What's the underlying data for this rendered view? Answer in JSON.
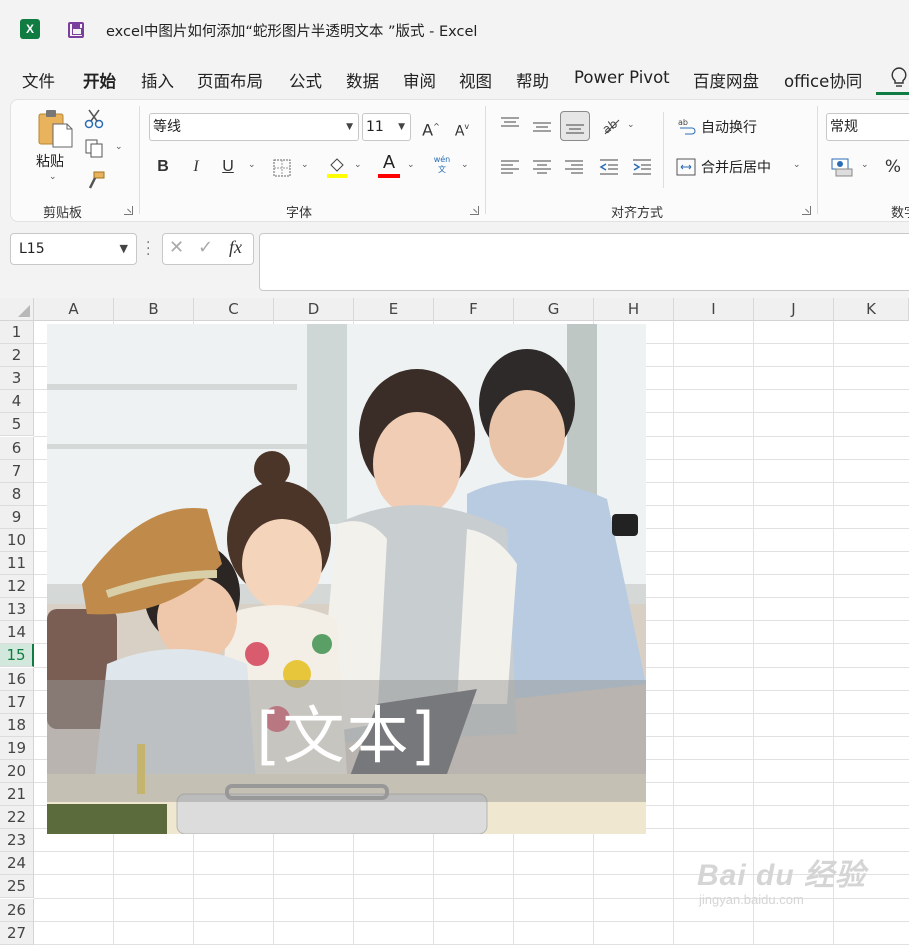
{
  "window": {
    "title": "excel中图片如何添加“蛇形图片半透明文本 ”版式  -  Excel",
    "logo_letter": "X"
  },
  "menu": {
    "tabs": [
      "文件",
      "开始",
      "插入",
      "页面布局",
      "公式",
      "数据",
      "审阅",
      "视图",
      "帮助",
      "Power Pivot",
      "百度网盘",
      "office协同"
    ],
    "active": "开始"
  },
  "ribbon": {
    "clipboard": {
      "paste_label": "粘贴",
      "group_label": "剪贴板"
    },
    "font": {
      "font_name": "等线",
      "font_size": "11",
      "grow": "A",
      "shrink": "A",
      "bold": "B",
      "italic": "I",
      "underline": "U",
      "font_color_letter": "A",
      "phonetic": "wén 文",
      "group_label": "字体"
    },
    "alignment": {
      "wrap_text": "自动换行",
      "merge_center": "合并后居中",
      "group_label": "对齐方式"
    },
    "number": {
      "format": "常规",
      "percent": "%",
      "group_label": "数字"
    },
    "colors": {
      "accent": "#107c41",
      "highlight": "#ffff00",
      "font_color": "#ff0000"
    }
  },
  "formula_bar": {
    "name_box": "L15",
    "cancel": "✕",
    "enter": "✓",
    "fx": "fx",
    "value": ""
  },
  "sheet": {
    "columns": [
      "A",
      "B",
      "C",
      "D",
      "E",
      "F",
      "G",
      "H",
      "I",
      "J",
      "K"
    ],
    "rows": [
      "1",
      "2",
      "3",
      "4",
      "5",
      "6",
      "7",
      "8",
      "9",
      "10",
      "11",
      "12",
      "13",
      "14",
      "15",
      "16",
      "17",
      "18",
      "19",
      "20",
      "21",
      "22",
      "23",
      "24",
      "25",
      "26",
      "27"
    ],
    "selected_row": "15"
  },
  "picture": {
    "banner_text": "[文本]"
  },
  "watermark": {
    "logo": "Bai du 经验",
    "url": "jingyan.baidu.com"
  }
}
